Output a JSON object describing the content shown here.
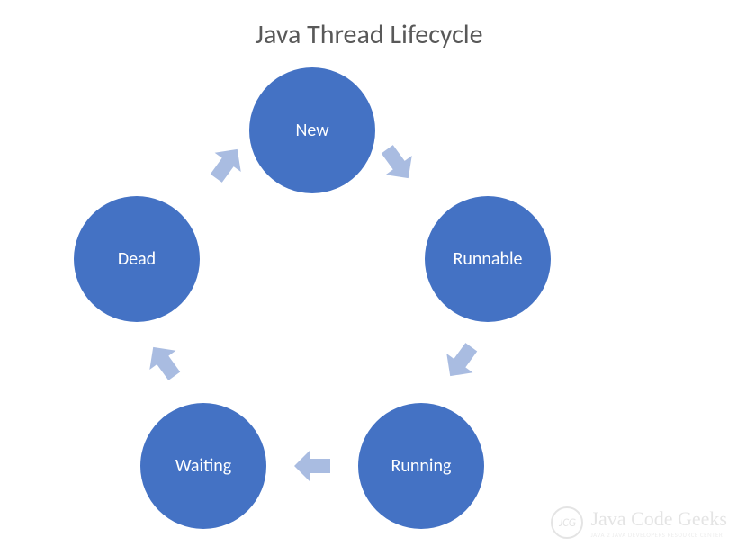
{
  "title": "Java Thread Lifecycle",
  "nodes": [
    {
      "id": "new",
      "label": "New"
    },
    {
      "id": "runnable",
      "label": "Runnable"
    },
    {
      "id": "running",
      "label": "Running"
    },
    {
      "id": "waiting",
      "label": "Waiting"
    },
    {
      "id": "dead",
      "label": "Dead"
    }
  ],
  "edges": [
    {
      "from": "new",
      "to": "runnable"
    },
    {
      "from": "runnable",
      "to": "running"
    },
    {
      "from": "running",
      "to": "waiting"
    },
    {
      "from": "waiting",
      "to": "dead"
    },
    {
      "from": "dead",
      "to": "new"
    }
  ],
  "colors": {
    "circle": "#4472c4",
    "arrow": "#a9bce1",
    "title": "#595959"
  },
  "watermark": {
    "logo": "JCG",
    "main": "Java Code Geeks",
    "sub": "JAVA 2 JAVA DEVELOPERS RESOURCE CENTER"
  }
}
